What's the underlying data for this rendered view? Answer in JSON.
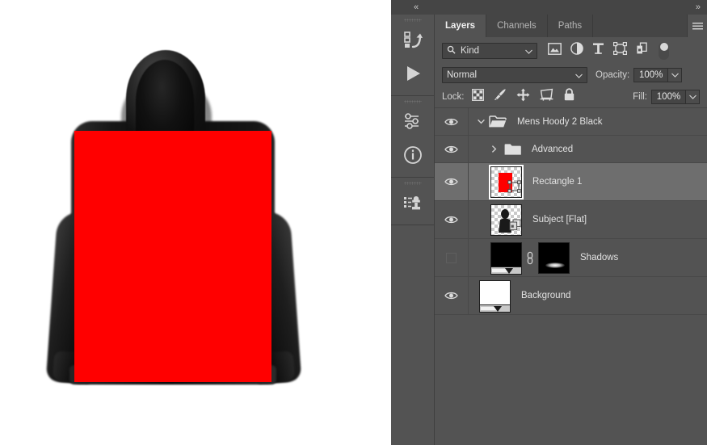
{
  "app": {
    "name": "photoshop-layers-panel"
  },
  "canvas": {
    "background_color": "#ffffff",
    "shape_color": "#ff0000",
    "garment_color": "#0d0d0d",
    "description": "Black hoody product photo with red rectangle shape overlay"
  },
  "dock": {
    "collapse_left_label": "«",
    "expand_right_label": "»"
  },
  "icon_rail": {
    "groups": [
      {
        "icons": [
          {
            "name": "history-icon",
            "title": "History"
          },
          {
            "name": "play-icon",
            "title": "Actions"
          }
        ]
      },
      {
        "icons": [
          {
            "name": "adjustments-icon",
            "title": "Adjustments"
          },
          {
            "name": "info-icon",
            "title": "Info"
          }
        ]
      },
      {
        "icons": [
          {
            "name": "clone-source-icon",
            "title": "Clone Source"
          }
        ]
      }
    ]
  },
  "tabs": [
    {
      "label": "Layers",
      "active": true
    },
    {
      "label": "Channels",
      "active": false
    },
    {
      "label": "Paths",
      "active": false
    }
  ],
  "panel_menu": {
    "name": "panel-menu-icon",
    "label": "≡"
  },
  "filter": {
    "kind_label": "Kind",
    "search_icon": "search-icon",
    "chevron": "⌄",
    "icons": [
      {
        "name": "filter-pixel-icon",
        "title": "Pixel layers filter"
      },
      {
        "name": "filter-adjustment-icon",
        "title": "Adjustment layers filter"
      },
      {
        "name": "filter-type-icon",
        "title": "Type layers filter",
        "glyph": "T"
      },
      {
        "name": "filter-shape-icon",
        "title": "Shape layers filter"
      },
      {
        "name": "filter-smartobject-icon",
        "title": "Smart object filter"
      }
    ],
    "toggle": {
      "name": "filter-enable-toggle",
      "state": "on"
    }
  },
  "blend": {
    "mode": "Normal",
    "opacity_label": "Opacity:",
    "opacity_value": "100%",
    "fill_label": "Fill:",
    "fill_value": "100%",
    "chevron": "⌄"
  },
  "lock": {
    "label": "Lock:",
    "icons": [
      {
        "name": "lock-transparent-pixels-icon",
        "title": "Lock transparent pixels"
      },
      {
        "name": "lock-image-pixels-icon",
        "title": "Lock image pixels"
      },
      {
        "name": "lock-position-icon",
        "title": "Lock position"
      },
      {
        "name": "lock-nesting-icon",
        "title": "Prevent auto-nesting"
      },
      {
        "name": "lock-all-icon",
        "title": "Lock all"
      }
    ]
  },
  "layers": [
    {
      "name": "Mens Hoody 2 Black",
      "type": "group",
      "visible": true,
      "expanded": true,
      "selected": false,
      "indent": 0,
      "thumb": "none"
    },
    {
      "name": "Advanced",
      "type": "group",
      "visible": true,
      "expanded": false,
      "selected": false,
      "indent": 1,
      "thumb": "none"
    },
    {
      "name": "Rectangle 1",
      "type": "shape",
      "visible": true,
      "selected": true,
      "indent": 1,
      "thumb": "red-rectangle-transparent",
      "badge": "vector-mask-badge"
    },
    {
      "name": "Subject [Flat]",
      "type": "smart-object",
      "visible": true,
      "selected": false,
      "indent": 1,
      "thumb": "subject-silhouette-transparent",
      "badge": "smart-object-badge"
    },
    {
      "name": "Shadows",
      "type": "gradient-fill",
      "visible": false,
      "selected": false,
      "indent": 1,
      "thumb": "black-gradient",
      "linked": true,
      "mask": "shadow-glow-mask"
    },
    {
      "name": "Background",
      "type": "gradient-fill",
      "visible": true,
      "selected": false,
      "indent": 0,
      "thumb": "white-gradient"
    }
  ],
  "colors": {
    "panel_bg": "#535353",
    "panel_dark": "#454545",
    "selected_row": "#6e6e6e",
    "text": "#e2e2e2",
    "accent_red": "#ff0000"
  }
}
